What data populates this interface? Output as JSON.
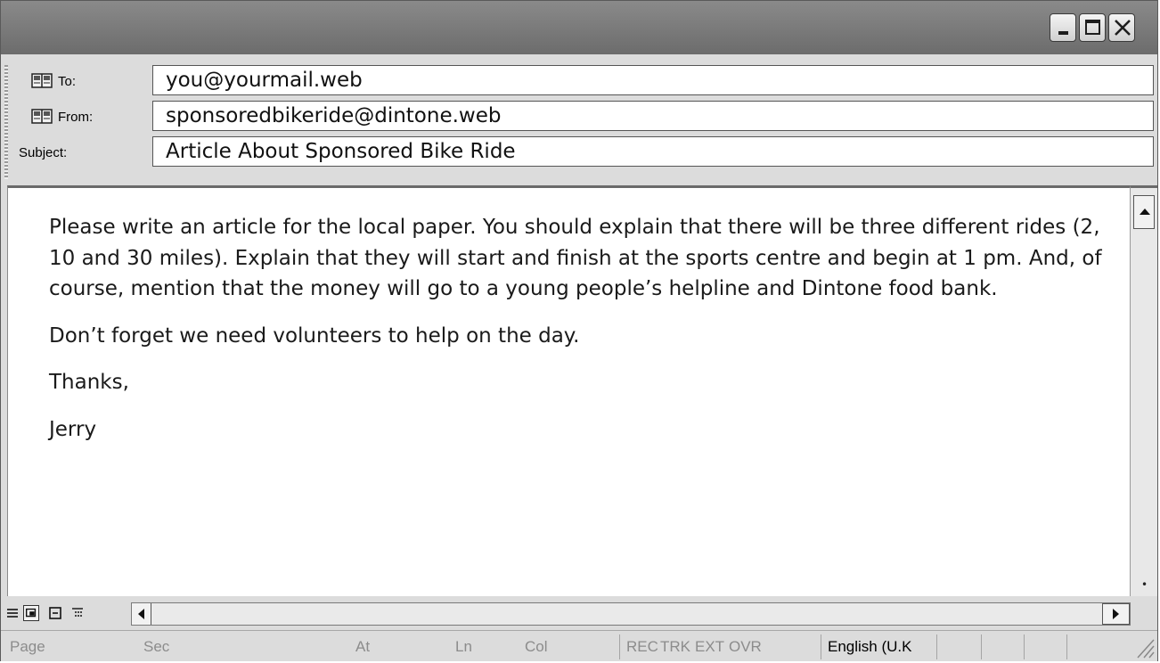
{
  "window": {
    "controls": {
      "minimize": "minimize",
      "maximize": "maximize",
      "close": "close"
    }
  },
  "header": {
    "to": {
      "label": "To:",
      "value": "you@yourmail.web"
    },
    "from": {
      "label": "From:",
      "value": "sponsoredbikeride@dintone.web"
    },
    "subject": {
      "label": "Subject:",
      "value": "Article About Sponsored Bike Ride"
    }
  },
  "body": {
    "paragraphs": [
      "Please write an article for the local paper. You should explain that there will be three different rides (2, 10 and 30 miles). Explain that they will start and finish at the sports centre and begin at 1 pm. And, of course, mention that the money will go to a young people’s helpline and Dintone food bank.",
      "Don’t forget we need volunteers to help on the day.",
      "Thanks,",
      "Jerry"
    ]
  },
  "status_bar": {
    "page": "Page",
    "sec": "Sec",
    "at": "At",
    "ln": "Ln",
    "col": "Col",
    "rec": "REC",
    "trk": "TRK",
    "ext": "EXT",
    "ovr": "OVR",
    "language": "English (U.K"
  },
  "icons": {
    "address_book": "address-book-icon",
    "view_modes": [
      "normal-view-icon",
      "web-layout-view-icon",
      "print-layout-view-icon",
      "outline-view-icon"
    ]
  }
}
